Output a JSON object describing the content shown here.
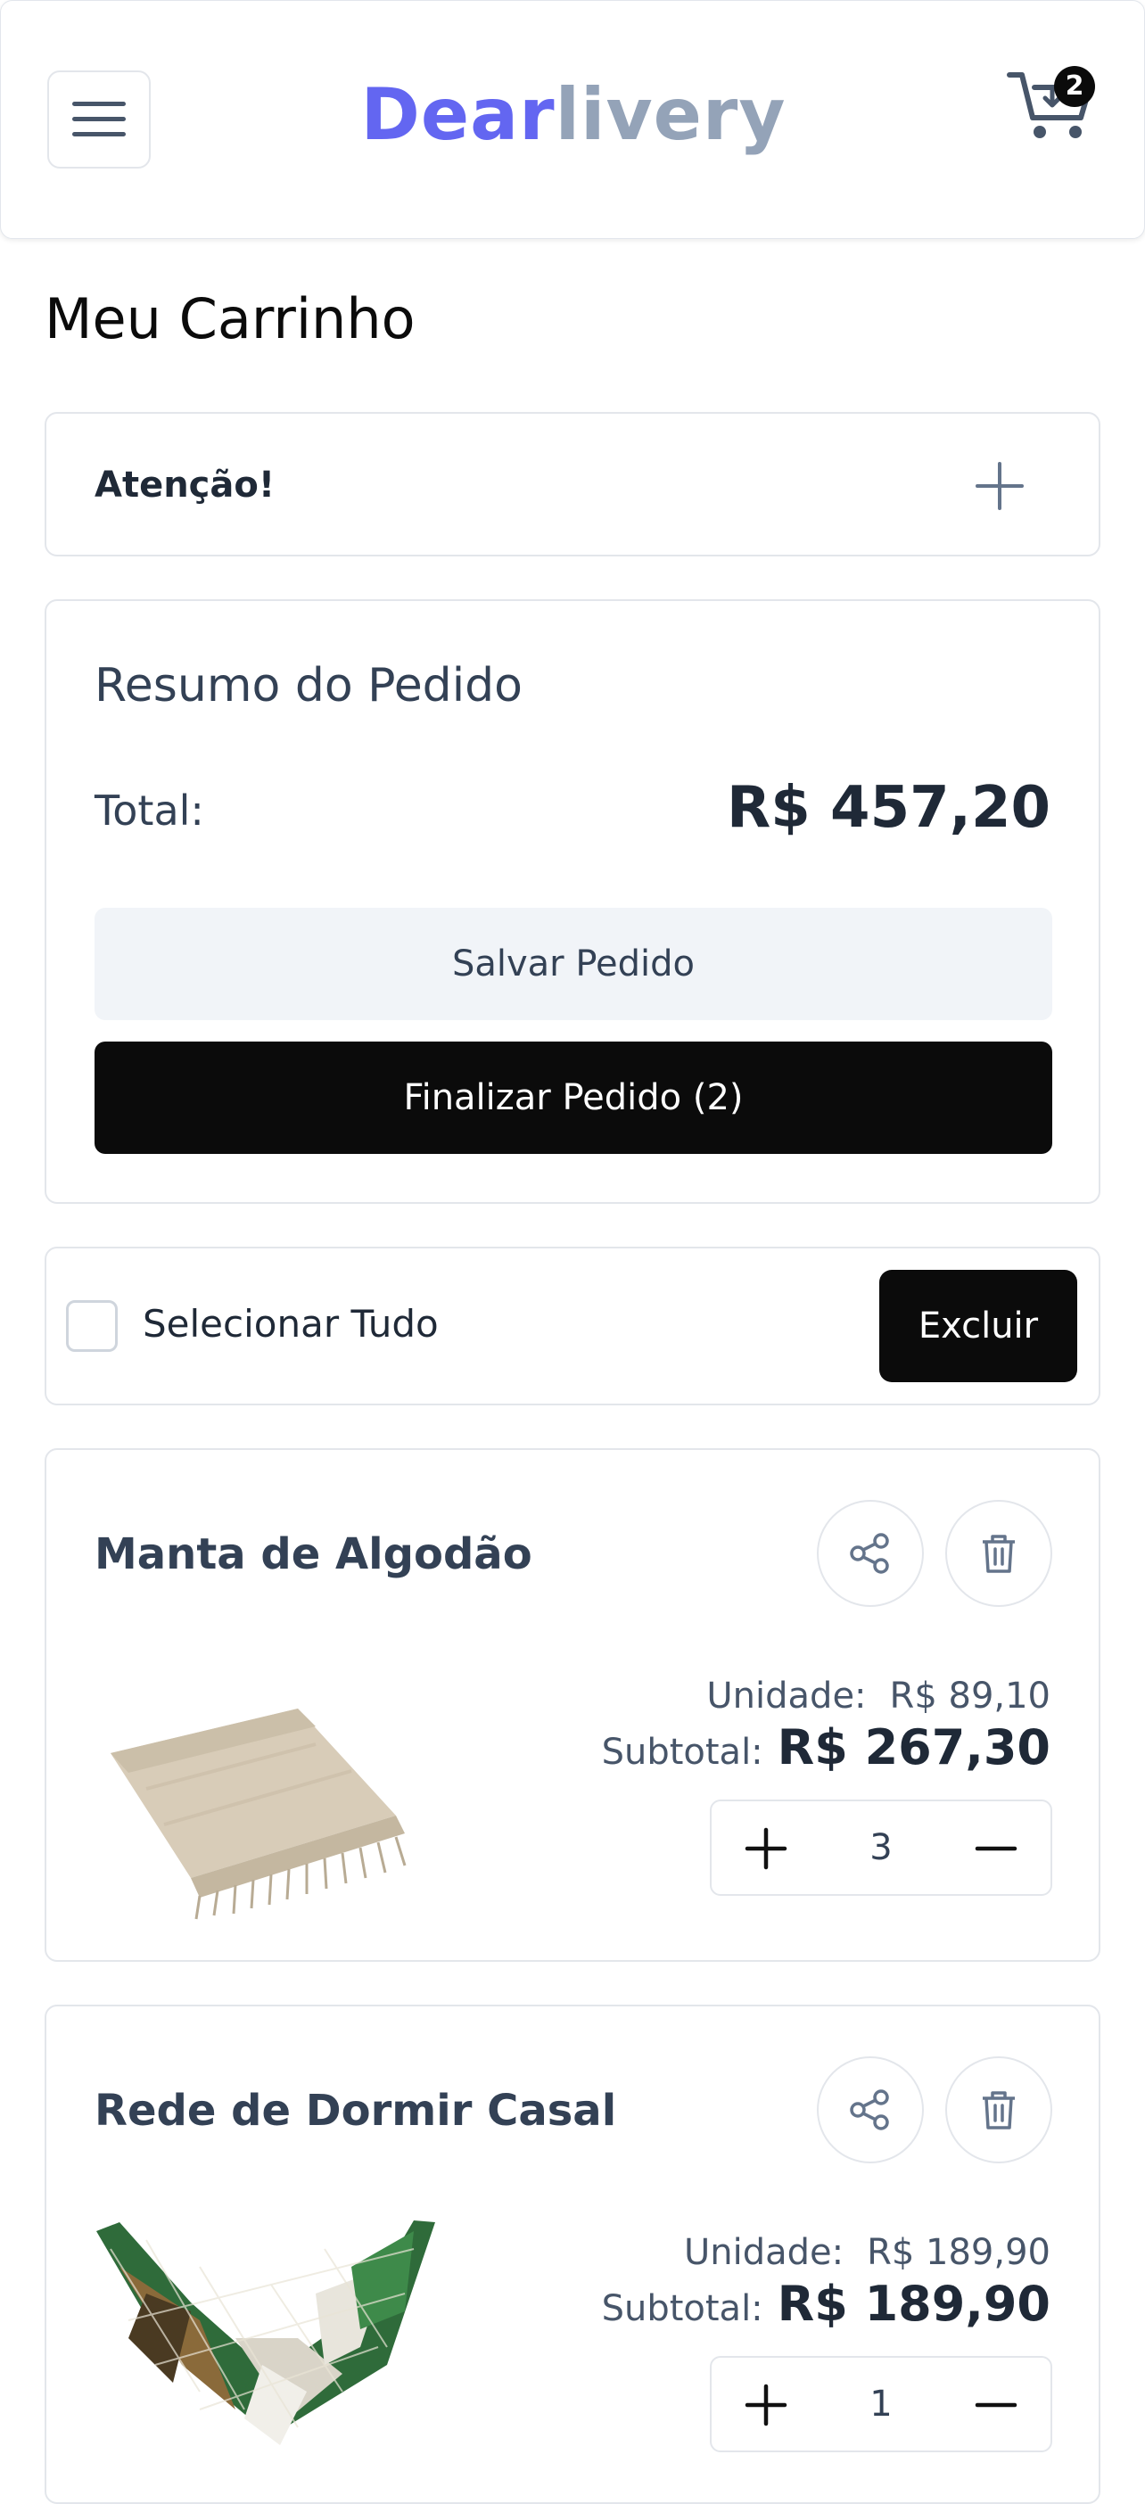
{
  "header": {
    "logo_part1": "Dear",
    "logo_part2": "livery",
    "cart_count": "2",
    "menu_icon": "hamburger-icon",
    "cart_icon": "cart-icon"
  },
  "page": {
    "title": "Meu Carrinho"
  },
  "attention": {
    "label": "Atenção!",
    "icon": "plus-icon"
  },
  "summary": {
    "title": "Resumo do Pedido",
    "total_label": "Total:",
    "total_value": "R$ 457,20",
    "save_label": "Salvar Pedido",
    "finish_label": "Finalizar Pedido (2)"
  },
  "selection": {
    "select_all_label": "Selecionar Tudo",
    "delete_label": "Excluir"
  },
  "products": [
    {
      "name": "Manta de Algodão",
      "unit_label": "Unidade:",
      "unit_price": "R$ 89,10",
      "subtotal_label": "Subtotal:",
      "subtotal": "R$ 267,30",
      "quantity": "3"
    },
    {
      "name": "Rede de Dormir Casal",
      "unit_label": "Unidade:",
      "unit_price": "R$ 189,90",
      "subtotal_label": "Subtotal:",
      "subtotal": "R$ 189,90",
      "quantity": "1"
    }
  ],
  "colors": {
    "brand_primary": "#6366f1",
    "brand_secondary": "#94a3b8",
    "primary_button": "#0b0b0b",
    "secondary_button": "#f1f4f8",
    "border": "#e3e6eb"
  }
}
